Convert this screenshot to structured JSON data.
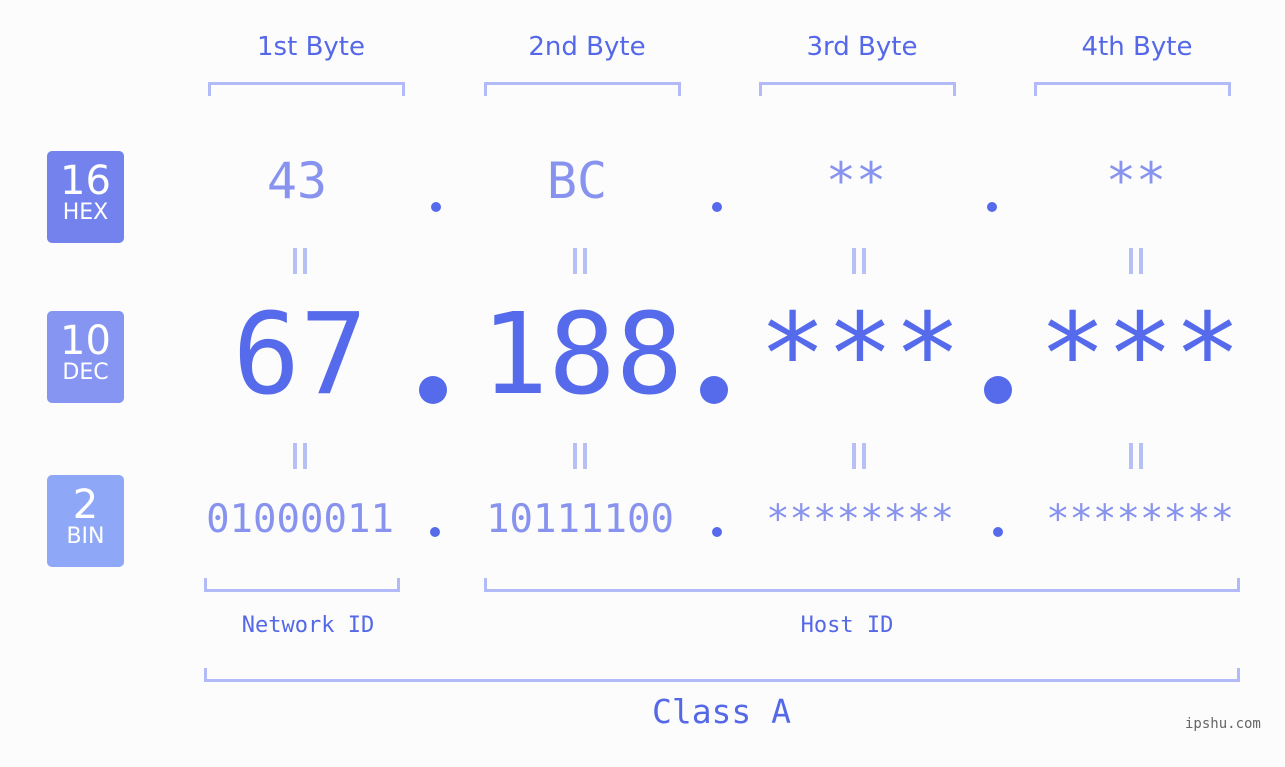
{
  "bytes": [
    {
      "label": "1st Byte",
      "hex": "43",
      "dec": "67",
      "bin": "01000011"
    },
    {
      "label": "2nd Byte",
      "hex": "BC",
      "dec": "188",
      "bin": "10111100"
    },
    {
      "label": "3rd Byte",
      "hex": "**",
      "dec": "***",
      "bin": "********"
    },
    {
      "label": "4th Byte",
      "hex": "**",
      "dec": "***",
      "bin": "********"
    }
  ],
  "badges": {
    "hex": {
      "num": "16",
      "label": "HEX",
      "color": "#7382ec"
    },
    "dec": {
      "num": "10",
      "label": "DEC",
      "color": "#8595f1"
    },
    "bin": {
      "num": "2",
      "label": "BIN",
      "color": "#8fa7f7"
    }
  },
  "segments": {
    "network": "Network ID",
    "host": "Host ID"
  },
  "ip_class": "Class A",
  "watermark": "ipshu.com",
  "colors": {
    "accent": "#566beb",
    "light_text": "#8793ee",
    "bracket": "#b2bbf7"
  }
}
